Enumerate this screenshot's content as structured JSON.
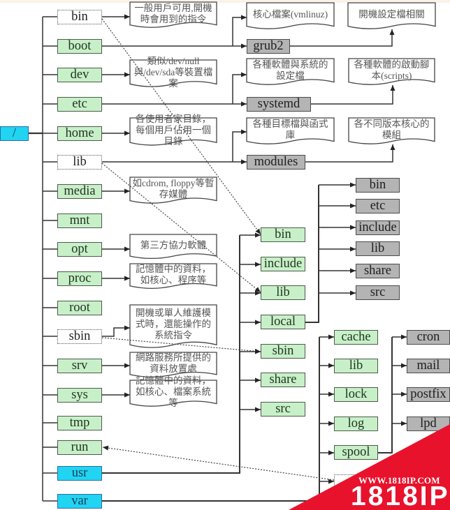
{
  "colors": {
    "dir_green": "#c8f0c8",
    "dir_gray": "#b4b4b4",
    "dir_cyan": "#21d4f2",
    "watermark_red": "#e8122c"
  },
  "root": {
    "label": "/"
  },
  "top_dirs": [
    {
      "name": "bin",
      "style": "symlink",
      "note": "一般用戶可用,開機時會用到的指令"
    },
    {
      "name": "boot",
      "style": "normal"
    },
    {
      "name": "dev",
      "style": "normal",
      "note": "類似/dev/null與/dev/sda等裝置檔案"
    },
    {
      "name": "etc",
      "style": "normal"
    },
    {
      "name": "home",
      "style": "normal",
      "note": "各使用者家目錄，每個用戶佔用一個目錄"
    },
    {
      "name": "lib",
      "style": "symlink"
    },
    {
      "name": "media",
      "style": "normal",
      "note": "如cdrom, floppy等暫存媒體"
    },
    {
      "name": "mnt",
      "style": "normal"
    },
    {
      "name": "opt",
      "style": "normal",
      "note": "第三方協力軟體"
    },
    {
      "name": "proc",
      "style": "normal",
      "note": "記憶體中的資料，如核心、程序等"
    },
    {
      "name": "root",
      "style": "normal"
    },
    {
      "name": "sbin",
      "style": "symlink",
      "note": "開機或單人維護模式時，還能操作的系統指令"
    },
    {
      "name": "srv",
      "style": "normal",
      "note": "網路服務所提供的資料放置處"
    },
    {
      "name": "sys",
      "style": "normal",
      "note": "記憶體中的資料，如核心、檔案系統等"
    },
    {
      "name": "tmp",
      "style": "normal"
    },
    {
      "name": "run",
      "style": "normal"
    },
    {
      "name": "usr",
      "style": "highlight"
    },
    {
      "name": "var",
      "style": "highlight"
    }
  ],
  "boot": {
    "note": "核心檔案(vmlinuz)",
    "child": "grub2",
    "child_note": "開機設定檔相關"
  },
  "etc": {
    "note": "各種軟體與系統的設定檔",
    "child": "systemd",
    "child_note": "各種軟體的啟動腳本(scripts)"
  },
  "lib": {
    "note": "各種目標檔與函式庫",
    "child": "modules",
    "child_note": "各不同版本核心的模組"
  },
  "usr": {
    "children": [
      "bin",
      "include",
      "lib",
      "local",
      "sbin",
      "share",
      "src"
    ],
    "local_children": [
      "bin",
      "etc",
      "include",
      "lib",
      "share",
      "src"
    ]
  },
  "var": {
    "children": [
      "cache",
      "lib",
      "lock",
      "log",
      "spool"
    ],
    "spool_children": [
      "cron",
      "mail",
      "postfix",
      "lpd"
    ]
  },
  "symlink_arrows": [
    {
      "from": "/bin",
      "to": "/usr/bin"
    },
    {
      "from": "/lib",
      "to": "/usr/lib"
    },
    {
      "from": "/sbin",
      "to": "/usr/sbin"
    },
    {
      "from": "/var/run",
      "to": "/run"
    }
  ],
  "watermark": {
    "url": "WWW.1818IP.COM",
    "brand": "1818IP"
  }
}
